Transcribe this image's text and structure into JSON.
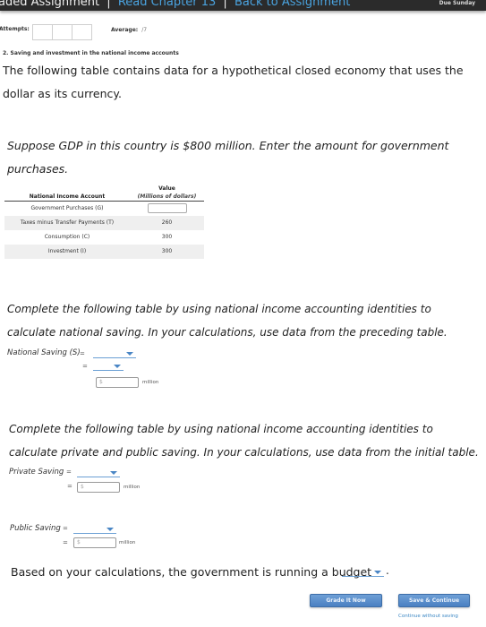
{
  "header": {
    "crumb_current": "aded Assignment",
    "crumb_links": [
      "Read Chapter 13",
      "Back to Assignment"
    ],
    "separator": "|",
    "due_text": "Due Sunday"
  },
  "attempts": {
    "label": "Attempts:",
    "box_count": 3,
    "average_label": "Average:",
    "average_value": "/7"
  },
  "question": {
    "title": "2. Saving and investment in the national income accounts",
    "intro": "The following table contains data for a hypothetical closed economy that uses the dollar as its currency.",
    "gdp_prompt": "Suppose GDP in this country is $800 million. Enter the amount for government purchases."
  },
  "table": {
    "col1_header": "National Income Account",
    "col2_header": "Value",
    "col2_subheader": "(Millions of dollars)",
    "rows": [
      {
        "account": "Government Purchases (G)",
        "value": "",
        "input": true
      },
      {
        "account": "Taxes minus Transfer Payments (T)",
        "value": "260",
        "input": false
      },
      {
        "account": "Consumption (C)",
        "value": "300",
        "input": false
      },
      {
        "account": "Investment (I)",
        "value": "300",
        "input": false
      }
    ]
  },
  "national_saving": {
    "prompt": "Complete the following table by using national income accounting identities to calculate national saving. In your calculations, use data from the preceding table.",
    "label": "National Saving (S)",
    "equals": "=",
    "placeholder": "$",
    "unit": "million"
  },
  "private_public": {
    "prompt": "Complete the following table by using national income accounting identities to calculate private and public saving. In your calculations, use data from the initial table.",
    "private_label": "Private Saving",
    "public_label": "Public Saving",
    "equals": "=",
    "placeholder": "$",
    "unit": "million"
  },
  "budget": {
    "sentence": "Based on your calculations, the government is running a budget",
    "period": "."
  },
  "footer": {
    "grade_button": "Grade It Now",
    "save_button": "Save & Continue",
    "continue_link": "Continue without saving"
  }
}
